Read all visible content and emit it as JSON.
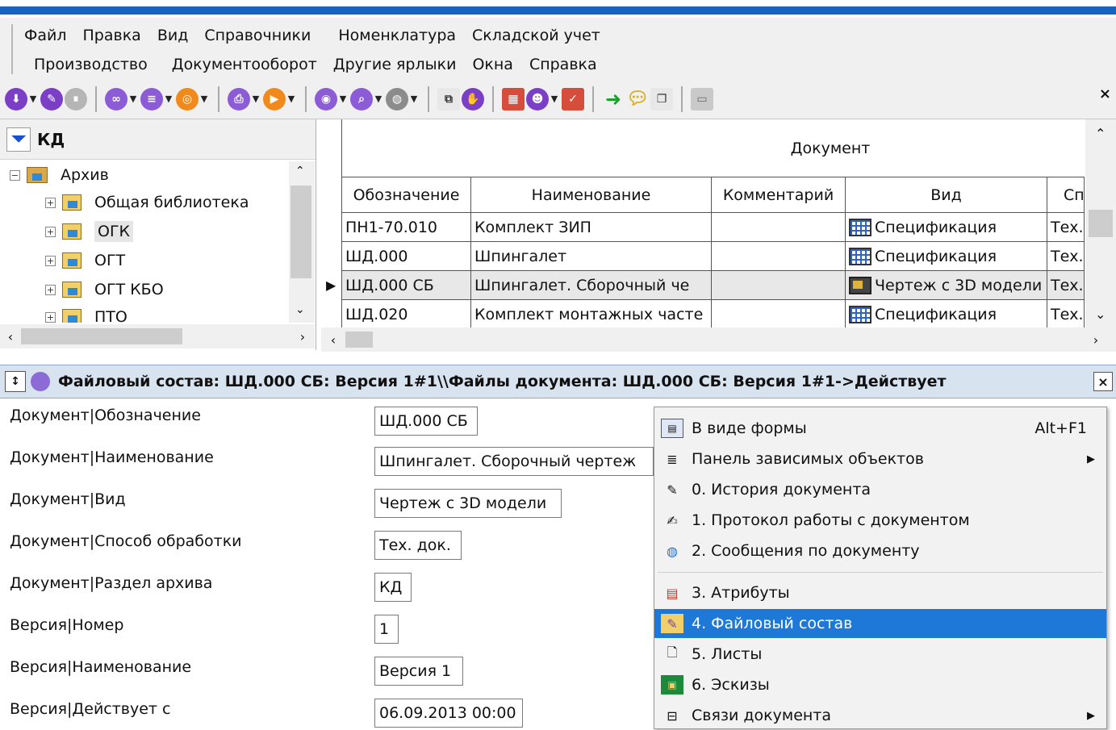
{
  "menu": {
    "row1": [
      "Файл",
      "Правка",
      "Вид",
      "Справочники",
      "Номенклатура",
      "Складской учет"
    ],
    "row2": [
      "Производство",
      "Документооборот",
      "Другие ярлыки",
      "Окна",
      "Справка"
    ]
  },
  "left_panel": {
    "title": "КД",
    "tree": [
      {
        "label": "Архив"
      },
      {
        "label": "Общая библиотека"
      },
      {
        "label": "ОГК"
      },
      {
        "label": "ОГТ"
      },
      {
        "label": "ОГТ КБО"
      },
      {
        "label": "ПТО"
      }
    ]
  },
  "grid": {
    "group_header": "Документ",
    "columns": [
      "Обозначение",
      "Наименование",
      "Комментарий",
      "Вид",
      "Сп"
    ],
    "rows": [
      {
        "code": "ПН1-70.010",
        "name": "Комплект ЗИП",
        "comment": "",
        "kind": "Спецификация",
        "method": "Тех."
      },
      {
        "code": "ШД.000",
        "name": "Шпингалет",
        "comment": "",
        "kind": "Спецификация",
        "method": "Тех."
      },
      {
        "code": "ШД.000 СБ",
        "name": "Шпингалет. Сборочный че",
        "comment": "",
        "kind": "Чертеж с 3D модели",
        "method": "Тех."
      },
      {
        "code": "ШД.020",
        "name": "Комплект монтажных часте",
        "comment": "",
        "kind": "Спецификация",
        "method": "Тех."
      }
    ]
  },
  "status": {
    "text": "Файловый состав: ШД.000 СБ: Версия 1#1\\\\Файлы документа: ШД.000 СБ: Версия 1#1->Действует"
  },
  "form": {
    "fields": [
      {
        "label": "Документ|Обозначение",
        "value": "ШД.000 СБ"
      },
      {
        "label": "Документ|Наименование",
        "value": "Шпингалет. Сборочный чертеж"
      },
      {
        "label": "Документ|Вид",
        "value": "Чертеж с 3D модели"
      },
      {
        "label": "Документ|Способ обработки",
        "value": "Тех. док."
      },
      {
        "label": "Документ|Раздел архива",
        "value": "КД"
      },
      {
        "label": "Версия|Номер",
        "value": "1"
      },
      {
        "label": "Версия|Наименование",
        "value": "Версия 1"
      },
      {
        "label": "Версия|Действует с",
        "value": "06.09.2013 00:00"
      }
    ]
  },
  "context_menu": {
    "items": [
      {
        "label": "В виде формы",
        "shortcut": "Alt+F1",
        "icon": "form-icon"
      },
      {
        "label": "Панель зависимых объектов",
        "submenu": true,
        "icon": "list-icon"
      },
      {
        "label": "0. История документа",
        "icon": "history-icon"
      },
      {
        "label": "1. Протокол работы с документом",
        "icon": "protocol-icon"
      },
      {
        "label": "2. Сообщения по документу",
        "icon": "messages-icon"
      },
      {
        "label": "3. Атрибуты",
        "icon": "attributes-icon"
      },
      {
        "label": "4. Файловый состав",
        "icon": "files-icon",
        "highlighted": true
      },
      {
        "label": "5. Листы",
        "icon": "page-icon"
      },
      {
        "label": "6. Эскизы",
        "icon": "sketch-icon"
      },
      {
        "label": "Связи документа",
        "submenu": true,
        "icon": "links-icon"
      }
    ]
  },
  "colors": {
    "accent": "#1565c0",
    "highlight": "#1e78d7",
    "status_bg": "#d8e3f0"
  }
}
